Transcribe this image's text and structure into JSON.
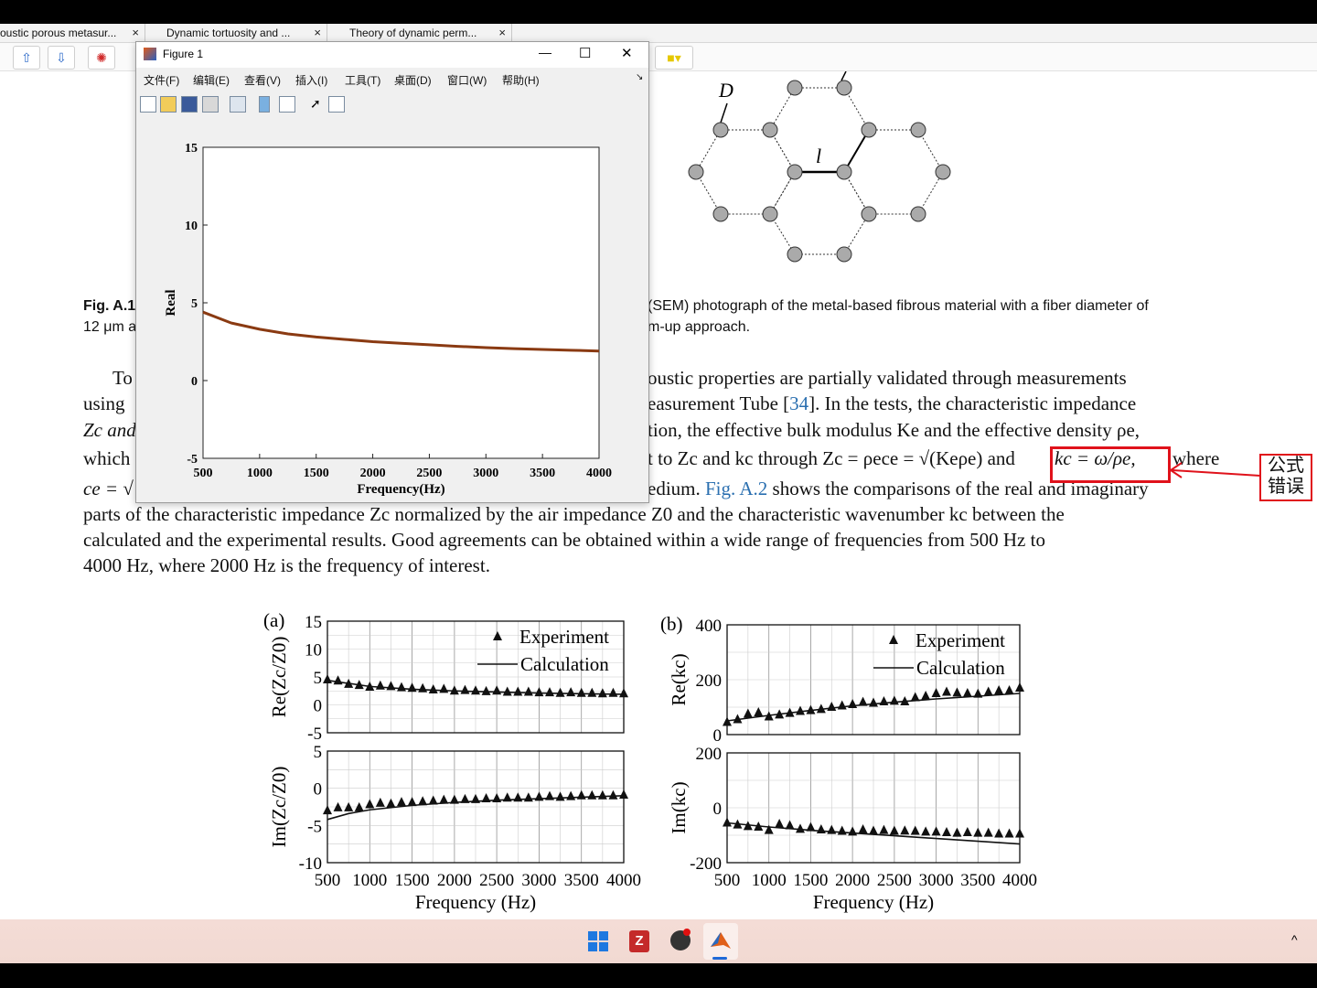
{
  "tabs": [
    {
      "label": "oustic porous metasur...",
      "close": "×"
    },
    {
      "label": "Dynamic tortuosity and ...",
      "close": "×"
    },
    {
      "label": "Theory of dynamic perm...",
      "close": "×"
    }
  ],
  "figure_window": {
    "title": "Figure 1",
    "menu": [
      "文件(F)",
      "编辑(E)",
      "查看(V)",
      "插入(I)",
      "工具(T)",
      "桌面(D)",
      "窗口(W)",
      "帮助(H)"
    ],
    "controls": {
      "minimize": "—",
      "maximize": "☐",
      "close": "✕"
    }
  },
  "chart_data": [
    {
      "type": "line",
      "xlabel": "Frequency(Hz)",
      "ylabel": "Real",
      "xlim": [
        500,
        4000
      ],
      "ylim": [
        -5,
        15
      ],
      "xticks": [
        "500",
        "1000",
        "1500",
        "2000",
        "2500",
        "3000",
        "3500",
        "4000"
      ],
      "yticks": [
        "15",
        "10",
        "5",
        "0",
        "-5"
      ],
      "series": [
        {
          "color": "#8a3a12",
          "x": [
            500,
            750,
            1000,
            1250,
            1500,
            1750,
            2000,
            2250,
            2500,
            2750,
            3000,
            3250,
            3500,
            3750,
            4000
          ],
          "y": [
            4.4,
            3.7,
            3.3,
            3.0,
            2.8,
            2.65,
            2.5,
            2.4,
            2.3,
            2.2,
            2.12,
            2.05,
            2.0,
            1.95,
            1.9
          ]
        }
      ]
    },
    {
      "type": "line",
      "panel": "(a)",
      "ylabel": "Re(Zc/Z0)",
      "ylim": [
        -5,
        15
      ],
      "yticks": [
        "15",
        "10",
        "5",
        "0",
        "-5"
      ],
      "legend": [
        "Experiment",
        "Calculation"
      ],
      "experiment_x": [
        500,
        625,
        750,
        875,
        1000,
        1125,
        1250,
        1375,
        1500,
        1625,
        1750,
        1875,
        2000,
        2125,
        2250,
        2375,
        2500,
        2625,
        2750,
        2875,
        3000,
        3125,
        3250,
        3375,
        3500,
        3625,
        3750,
        3875,
        4000
      ],
      "experiment_y": [
        4.5,
        4.3,
        3.7,
        3.5,
        3.2,
        3.4,
        3.3,
        3.1,
        3.0,
        2.9,
        2.7,
        2.8,
        2.5,
        2.6,
        2.5,
        2.4,
        2.5,
        2.3,
        2.3,
        2.3,
        2.2,
        2.2,
        2.1,
        2.2,
        2.1,
        2.1,
        2.0,
        2.1,
        2.0
      ],
      "calc_x": [
        500,
        1000,
        1500,
        2000,
        2500,
        3000,
        3500,
        4000
      ],
      "calc_y": [
        4.4,
        3.3,
        2.8,
        2.5,
        2.3,
        2.12,
        2.0,
        1.9
      ]
    },
    {
      "type": "line",
      "ylabel": "Im(Zc/Z0)",
      "xlabel": "Frequency (Hz)",
      "ylim": [
        -10,
        5
      ],
      "yticks": [
        "5",
        "0",
        "-5",
        "-10"
      ],
      "xticks": [
        "500",
        "1000",
        "1500",
        "2000",
        "2500",
        "3000",
        "3500",
        "4000"
      ],
      "experiment_x": [
        500,
        625,
        750,
        875,
        1000,
        1125,
        1250,
        1375,
        1500,
        1625,
        1750,
        1875,
        2000,
        2125,
        2250,
        2375,
        2500,
        2625,
        2750,
        2875,
        3000,
        3125,
        3250,
        3375,
        3500,
        3625,
        3750,
        3875,
        4000
      ],
      "experiment_y": [
        -3.0,
        -2.6,
        -2.6,
        -2.6,
        -2.2,
        -2.0,
        -2.1,
        -1.9,
        -1.9,
        -1.8,
        -1.7,
        -1.6,
        -1.6,
        -1.5,
        -1.5,
        -1.4,
        -1.4,
        -1.3,
        -1.3,
        -1.3,
        -1.2,
        -1.1,
        -1.2,
        -1.1,
        -1.0,
        -1.0,
        -1.0,
        -1.0,
        -0.9
      ],
      "calc_x": [
        500,
        750,
        1000,
        1500,
        2000,
        2500,
        3000,
        3500,
        4000
      ],
      "calc_y": [
        -4.2,
        -3.4,
        -2.9,
        -2.3,
        -1.9,
        -1.6,
        -1.4,
        -1.2,
        -1.0
      ]
    },
    {
      "type": "line",
      "panel": "(b)",
      "ylabel": "Re(kc)",
      "ylim": [
        0,
        400
      ],
      "yticks": [
        "400",
        "200",
        "0"
      ],
      "legend": [
        "Experiment",
        "Calculation"
      ],
      "experiment_x": [
        500,
        625,
        750,
        875,
        1000,
        1125,
        1250,
        1375,
        1500,
        1625,
        1750,
        1875,
        2000,
        2125,
        2250,
        2375,
        2500,
        2625,
        2750,
        2875,
        3000,
        3125,
        3250,
        3375,
        3500,
        3625,
        3750,
        3875,
        4000
      ],
      "experiment_y": [
        45,
        55,
        75,
        80,
        65,
        72,
        78,
        85,
        88,
        92,
        100,
        105,
        110,
        118,
        115,
        120,
        122,
        120,
        135,
        140,
        150,
        155,
        152,
        150,
        148,
        155,
        160,
        160,
        170
      ],
      "calc_x": [
        500,
        1000,
        1500,
        2000,
        2500,
        3000,
        3500,
        4000
      ],
      "calc_y": [
        50,
        70,
        88,
        105,
        118,
        130,
        140,
        150
      ]
    },
    {
      "type": "line",
      "ylabel": "Im(kc)",
      "xlabel": "Frequency (Hz)",
      "ylim": [
        -200,
        200
      ],
      "yticks": [
        "200",
        "0",
        "-200"
      ],
      "xticks": [
        "500",
        "1000",
        "1500",
        "2000",
        "2500",
        "3000",
        "3500",
        "4000"
      ],
      "experiment_x": [
        500,
        625,
        750,
        875,
        1000,
        1125,
        1250,
        1375,
        1500,
        1625,
        1750,
        1875,
        2000,
        2125,
        2250,
        2375,
        2500,
        2625,
        2750,
        2875,
        3000,
        3125,
        3250,
        3375,
        3500,
        3625,
        3750,
        3875,
        4000
      ],
      "experiment_y": [
        -55,
        -62,
        -68,
        -70,
        -82,
        -60,
        -65,
        -78,
        -72,
        -80,
        -82,
        -85,
        -88,
        -80,
        -85,
        -82,
        -85,
        -84,
        -85,
        -88,
        -88,
        -90,
        -92,
        -90,
        -92,
        -92,
        -95,
        -95,
        -95
      ],
      "calc_x": [
        500,
        1000,
        1500,
        2000,
        2500,
        3000,
        3500,
        4000
      ],
      "calc_y": [
        -55,
        -70,
        -82,
        -92,
        -102,
        -112,
        -122,
        -132
      ]
    }
  ],
  "document": {
    "fig_a1_caption_1": "Fig. A.1",
    "fig_a1_caption_2": "(SEM) photograph of the metal-based fibrous material with a fiber diameter of",
    "fig_a1_caption_3": "12 μm a",
    "fig_a1_caption_4": "m-up approach.",
    "hex_labels": {
      "D": "D",
      "l": "l"
    },
    "lines_left": [
      "To",
      "using",
      "Zc and",
      "which",
      "ce = √"
    ],
    "lines_right": [
      "oustic properties are partially validated through measurements",
      "easurement Tube [",
      "34",
      "]. In the tests, the characteristic impedance",
      "tion, the effective bulk modulus Ke and the effective density ρe,",
      "t to Zc and kc through Zc = ρece = √(Keρe) and",
      "kc = ω/ρe,",
      "where",
      "edium.",
      "Fig. A.2",
      "shows the comparisons of the real and imaginary"
    ],
    "full_lines": [
      "parts of the characteristic impedance Zc normalized by the air impedance Z0 and the characteristic wavenumber kc between the",
      "calculated and the experimental results. Good agreements can be obtained within a wide range of frequencies from 500 Hz to",
      "4000 Hz, where 2000 Hz is the frequency of interest."
    ],
    "annotation": "公式错误",
    "annotation_line1": "公式",
    "annotation_line2": "错误"
  },
  "taskbar": {
    "icons": [
      "windows-start",
      "zotero",
      "obs",
      "matlab"
    ],
    "tray": "^"
  },
  "colors": {
    "accent_red": "#e0121b",
    "matlab_line": "#8a3a12",
    "link": "#2a6fb0"
  }
}
